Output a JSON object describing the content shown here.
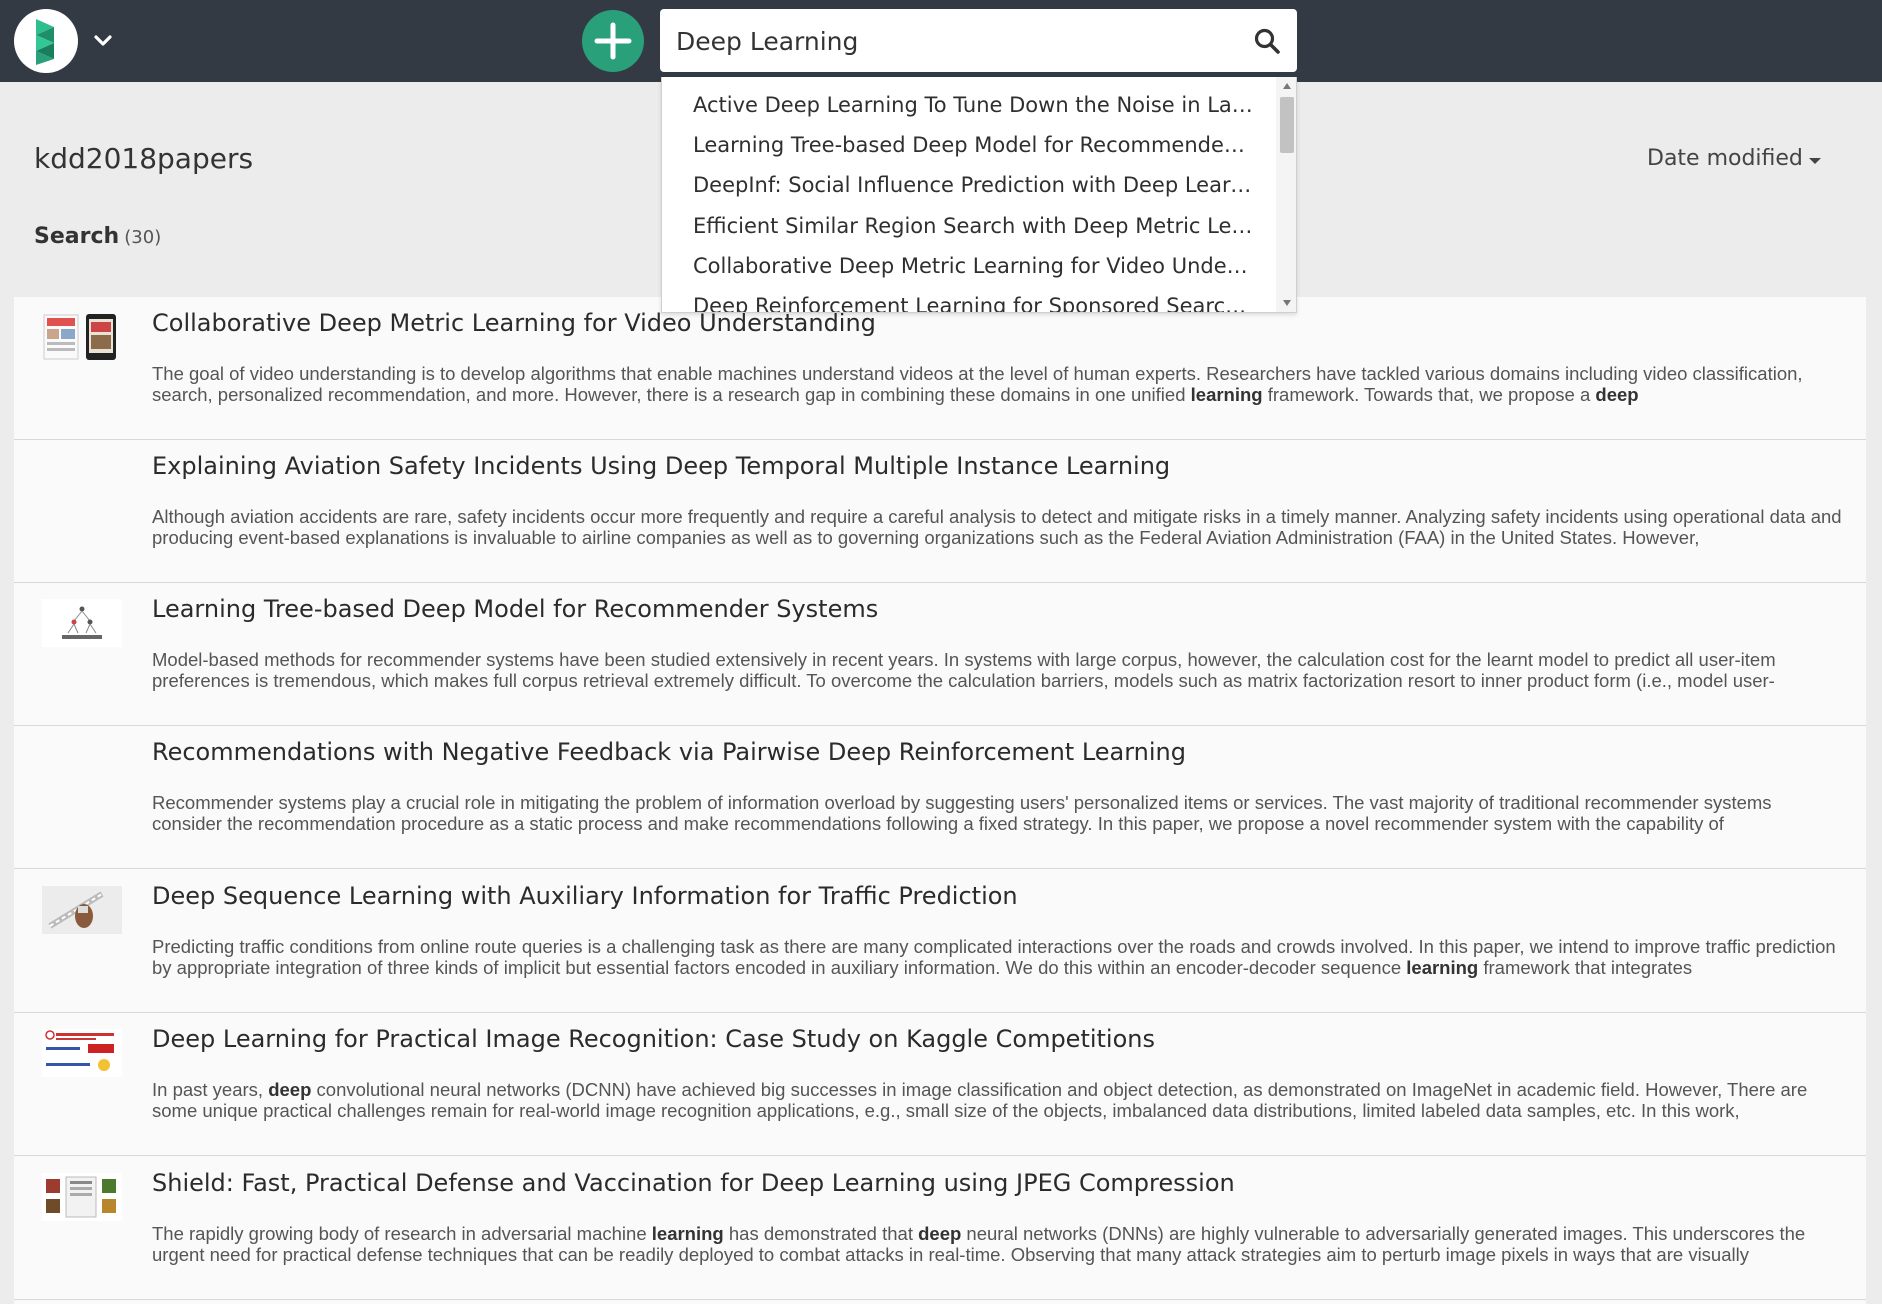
{
  "app": {
    "logo_icon": "app-logo-icon",
    "menu_icon": "chevron-down-icon",
    "add_icon": "plus-icon",
    "accent_color": "#2aa07a",
    "topbar_color": "#343a44"
  },
  "search": {
    "value": "Deep Learning",
    "icon": "search-icon",
    "suggestions": [
      "Active Deep Learning To Tune Down the Noise in Labels",
      "Learning Tree-based Deep Model for Recommender Systems",
      "DeepInf: Social Influence Prediction with Deep Learning",
      "Efficient Similar Region Search with Deep Metric Learning",
      "Collaborative Deep Metric Learning for Video Understanding",
      "Deep Reinforcement Learning for Sponsored Search Real-time Bidding"
    ]
  },
  "header": {
    "folder_title": "kdd2018papers",
    "sort_label": "Date modified",
    "search_label": "Search",
    "search_count": "(30)"
  },
  "results": [
    {
      "title": "Collaborative Deep Metric Learning for Video Understanding",
      "snippet": "The goal of video understanding is to develop algorithms that enable machines understand videos at the level of human experts. Researchers have tackled various domains including video classification, search, personalized recommendation, and more. However, there is a research gap in combining these domains in one unified **learning** framework. Towards that, we propose a **deep**",
      "thumbnail": "phones"
    },
    {
      "title": "Explaining Aviation Safety Incidents Using Deep Temporal Multiple Instance Learning",
      "snippet": "Although aviation accidents are rare, safety incidents occur more frequently and require a careful analysis to detect and mitigate risks in a timely manner. Analyzing safety incidents using operational data and producing event-based explanations is invaluable to airline companies as well as to governing organizations such as the Federal Aviation Administration (FAA) in the United States. However,",
      "thumbnail": ""
    },
    {
      "title": "Learning Tree-based Deep Model for Recommender Systems",
      "snippet": "Model-based methods for recommender systems have been studied extensively in recent years. In systems with large corpus, however, the calculation cost for the learnt model to predict all user-item preferences is tremendous, which makes full corpus retrieval extremely difficult. To overcome the calculation barriers, models such as matrix factorization resort to inner product form (i.e., model user-",
      "thumbnail": "tree"
    },
    {
      "title": "Recommendations with Negative Feedback via Pairwise Deep Reinforcement Learning",
      "snippet": "Recommender systems play a crucial role in mitigating the problem of information overload by suggesting users' personalized items or services. The vast majority of traditional recommender systems consider the recommendation procedure as a static process and make recommendations following a fixed strategy. In this paper, we propose a novel recommender system with the capability of",
      "thumbnail": ""
    },
    {
      "title": "Deep Sequence Learning with Auxiliary Information for Traffic Prediction",
      "snippet": "Predicting traffic conditions from online route queries is a challenging task as there are many complicated interactions over the roads and crowds involved. In this paper, we intend to improve traffic prediction by appropriate integration of three kinds of implicit but essential factors encoded in auxiliary information. We do this within an encoder-decoder sequence **learning** framework that integrates",
      "thumbnail": "road"
    },
    {
      "title": "Deep Learning for Practical Image Recognition: Case Study on Kaggle Competitions",
      "snippet": "In past years, **deep** convolutional neural networks (DCNN) have achieved big successes in image classification and object detection, as demonstrated on ImageNet in academic field. However, There are some unique practical challenges remain for real-world image recognition applications, e.g., small size of the objects, imbalanced data distributions, limited labeled data samples, etc. In this work,",
      "thumbnail": "slide"
    },
    {
      "title": "Shield: Fast, Practical Defense and Vaccination for Deep Learning using JPEG Compression",
      "snippet": "The rapidly growing body of research in adversarial machine **learning** has demonstrated that **deep** neural networks (DNNs) are highly vulnerable to adversarially generated images. This underscores the urgent need for practical defense techniques that can be readily deployed to combat attacks in real-time. Observing that many attack strategies aim to perturb image pixels in ways that are visually",
      "thumbnail": "grid"
    }
  ]
}
